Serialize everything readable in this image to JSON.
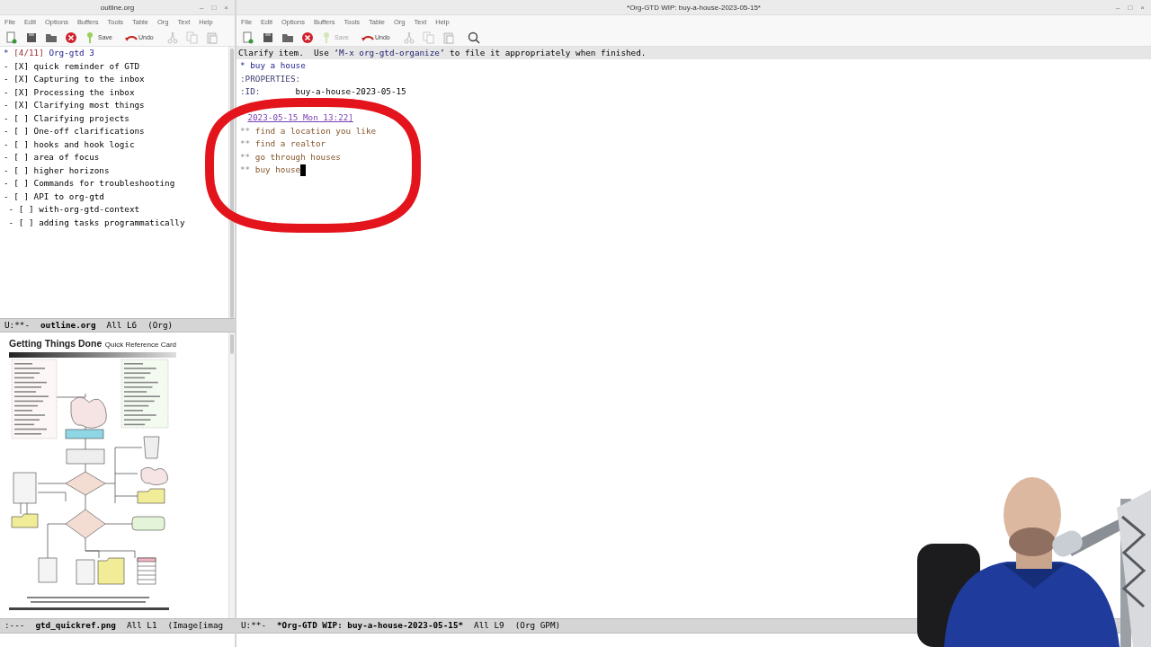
{
  "left_frame": {
    "title_bar": {
      "title": "outline.org",
      "controls": [
        "–",
        "□",
        "×"
      ]
    },
    "menu": [
      "File",
      "Edit",
      "Options",
      "Buffers",
      "Tools",
      "Table",
      "Org",
      "Text",
      "Help"
    ],
    "toolbar": [
      {
        "kind": "new",
        "disabled": false
      },
      {
        "kind": "open",
        "disabled": false
      },
      {
        "kind": "dired",
        "disabled": false
      },
      {
        "kind": "close",
        "disabled": false
      },
      {
        "kind": "save",
        "label": "Save",
        "disabled": false
      },
      {
        "kind": "undo",
        "label": "Undo",
        "disabled": false
      },
      {
        "kind": "cut",
        "disabled": true
      },
      {
        "kind": "copy",
        "disabled": true
      },
      {
        "kind": "paste",
        "disabled": true
      }
    ],
    "outline": {
      "lines": [
        {
          "kind": "heading",
          "stars": "*",
          "cookie": "[4/11]",
          "text": "Org-gtd 3"
        },
        {
          "kind": "item",
          "bullet": "-",
          "box": "[X]",
          "text": "quick reminder of GTD"
        },
        {
          "kind": "item",
          "bullet": "-",
          "box": "[X]",
          "text": "Capturing to the inbox"
        },
        {
          "kind": "item",
          "bullet": "-",
          "box": "[X]",
          "text": "Processing the inbox"
        },
        {
          "kind": "item",
          "bullet": "-",
          "box": "[X]",
          "text": "Clarifying most things"
        },
        {
          "kind": "item",
          "bullet": "-",
          "box": "[ ]",
          "text": "Clarifying projects"
        },
        {
          "kind": "item",
          "bullet": "-",
          "box": "[ ]",
          "text": "One-off clarifications"
        },
        {
          "kind": "item",
          "bullet": "-",
          "box": "[ ]",
          "text": "hooks and hook logic"
        },
        {
          "kind": "item",
          "bullet": "-",
          "box": "[ ]",
          "text": "area of focus"
        },
        {
          "kind": "item",
          "bullet": "-",
          "box": "[ ]",
          "text": "higher horizons"
        },
        {
          "kind": "item",
          "bullet": "-",
          "box": "[ ]",
          "text": "Commands for troubleshooting"
        },
        {
          "kind": "item",
          "bullet": "-",
          "box": "[ ]",
          "text": "API to org-gtd",
          "children": [
            {
              "kind": "item",
              "bullet": "-",
              "box": "[ ]",
              "text": "with-org-gtd-context"
            },
            {
              "kind": "item",
              "bullet": "-",
              "box": "[ ]",
              "text": "adding tasks programmatically"
            }
          ]
        }
      ],
      "mode_line": [
        {
          "kind": "status",
          "text": "U:**-"
        },
        {
          "kind": "buffer",
          "text": "outline.org"
        },
        {
          "kind": "position",
          "text": "All L6"
        },
        {
          "kind": "mode",
          "text": "(Org)"
        }
      ]
    },
    "image_buffer": {
      "title": "Getting Things Done",
      "subtitle": "Quick Reference Card",
      "diagram": {
        "kind": "flowchart"
      },
      "mode_line": [
        {
          "kind": "status",
          "text": ":---"
        },
        {
          "kind": "buffer",
          "text": "gtd_quickref.png"
        },
        {
          "kind": "position",
          "text": "All L1"
        },
        {
          "kind": "mode",
          "text": "(Image[imag"
        }
      ]
    }
  },
  "right_frame": {
    "title_bar": {
      "title": "*Org-GTD WIP: buy-a-house-2023-05-15*",
      "controls": [
        "–",
        "□",
        "×"
      ]
    },
    "menu": [
      "File",
      "Edit",
      "Options",
      "Buffers",
      "Tools",
      "Table",
      "Org",
      "Text",
      "Help"
    ],
    "toolbar": [
      {
        "kind": "new",
        "disabled": false
      },
      {
        "kind": "open",
        "disabled": false
      },
      {
        "kind": "dired",
        "disabled": false
      },
      {
        "kind": "close",
        "disabled": false
      },
      {
        "kind": "save",
        "label": "Save",
        "disabled": true
      },
      {
        "kind": "undo",
        "label": "Undo",
        "disabled": false
      },
      {
        "kind": "cut",
        "disabled": true
      },
      {
        "kind": "copy",
        "disabled": true
      },
      {
        "kind": "paste",
        "disabled": true
      },
      {
        "kind": "search",
        "disabled": false
      }
    ],
    "header_line": [
      {
        "kind": "plain",
        "text": "Clarify item.  Use ‘"
      },
      {
        "kind": "command",
        "text": "M-x org-gtd-organize"
      },
      {
        "kind": "plain",
        "text": "’ to file it appropriately when finished."
      }
    ],
    "lines": [
      {
        "kind": "heading",
        "stars": "*",
        "text": "buy a house"
      },
      {
        "kind": "drawer",
        "text": ":PROPERTIES:"
      },
      {
        "kind": "property",
        "key": ":ID:",
        "value": "buy-a-house-2023-05-15"
      },
      {
        "kind": "date",
        "text": "2023-05-15 Mon 13:22]"
      },
      {
        "kind": "subheading",
        "stars": "**",
        "text": "find a location you like",
        "cursor": false
      },
      {
        "kind": "subheading",
        "stars": "**",
        "text": "find a realtor",
        "cursor": false
      },
      {
        "kind": "subheading",
        "stars": "**",
        "text": "go through houses",
        "cursor": false
      },
      {
        "kind": "subheading",
        "stars": "**",
        "text": "buy house",
        "cursor": true
      }
    ],
    "mode_line": [
      {
        "kind": "status",
        "text": "U:**-"
      },
      {
        "kind": "buffer",
        "text": "*Org-GTD WIP: buy-a-house-2023-05-15*"
      },
      {
        "kind": "position",
        "text": "All L9"
      },
      {
        "kind": "mode",
        "text": "(Org GPM)"
      }
    ]
  },
  "annotation": {
    "kind": "ellipse"
  }
}
